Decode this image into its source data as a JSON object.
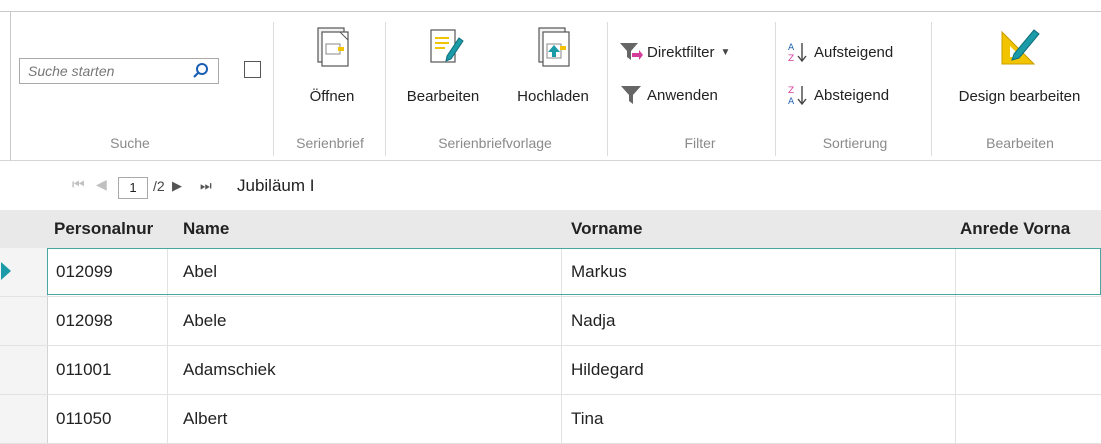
{
  "ribbon": {
    "search": {
      "placeholder": "Suche starten",
      "group_label": "Suche"
    },
    "serienbrief": {
      "open_label": "Öffnen",
      "group_label": "Serienbrief"
    },
    "vorlage": {
      "edit_label": "Bearbeiten",
      "upload_label": "Hochladen",
      "group_label": "Serienbriefvorlage"
    },
    "filter": {
      "direct_label": "Direktfilter",
      "apply_label": "Anwenden",
      "group_label": "Filter"
    },
    "sort": {
      "asc_label": "Aufsteigend",
      "desc_label": "Absteigend",
      "group_label": "Sortierung"
    },
    "edit": {
      "design_label": "Design bearbeiten",
      "group_label": "Bearbeiten"
    }
  },
  "pager": {
    "current": "1",
    "total": "/2",
    "record_title": "Jubiläum I"
  },
  "grid": {
    "columns": [
      "Personalnur",
      "Name",
      "Vorname",
      "Anrede Vorna"
    ],
    "rows": [
      {
        "personalnr": "012099",
        "name": "Abel",
        "vorname": "Markus",
        "anrede": ""
      },
      {
        "personalnr": "012098",
        "name": "Abele",
        "vorname": "Nadja",
        "anrede": ""
      },
      {
        "personalnr": "011001",
        "name": "Adamschiek",
        "vorname": "Hildegard",
        "anrede": ""
      },
      {
        "personalnr": "011050",
        "name": "Albert",
        "vorname": "Tina",
        "anrede": ""
      }
    ]
  },
  "colors": {
    "accent": "#1b9aa8",
    "selection_border": "#4aa6a0",
    "header_bg": "#e9e9e9"
  }
}
